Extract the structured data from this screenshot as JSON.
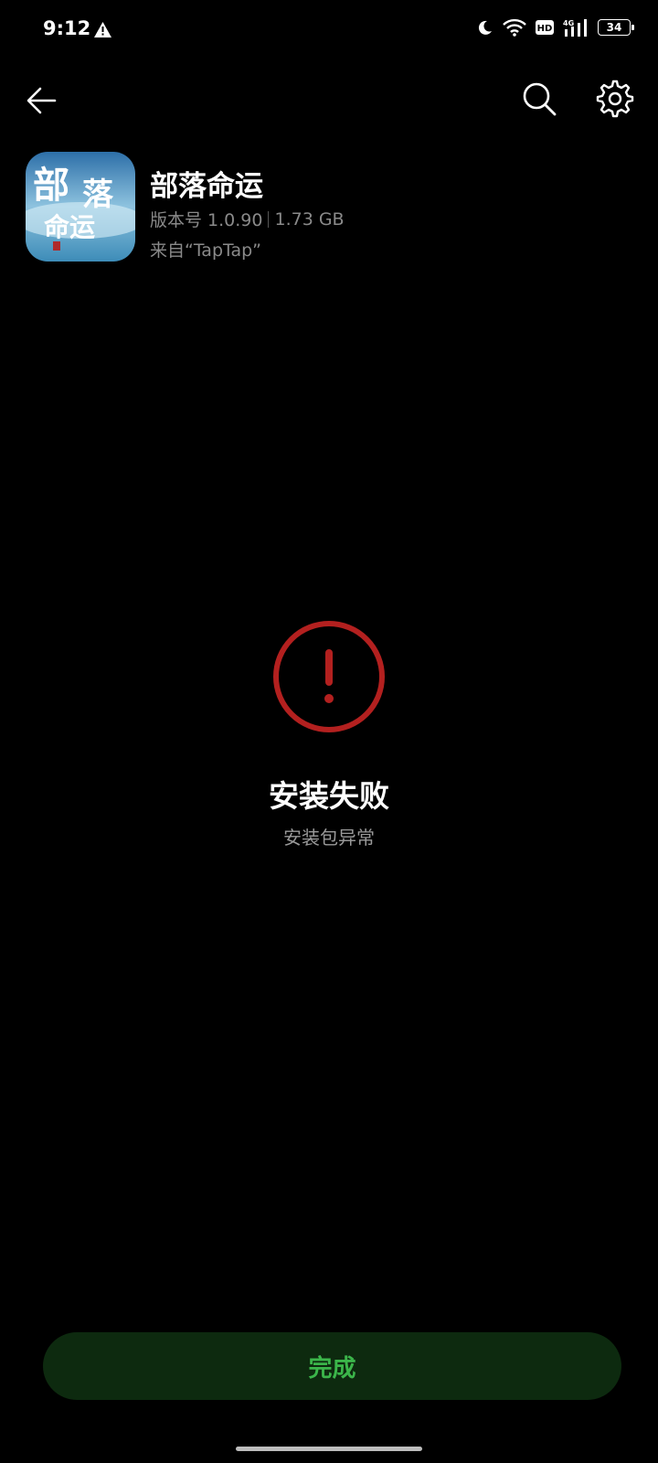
{
  "status_bar": {
    "time": "9:12",
    "warning_icon": "warning-triangle-icon",
    "icons": [
      "moon-icon",
      "wifi-icon",
      "hd-icon",
      "signal-4g-icon"
    ],
    "hd_label": "HD",
    "network_label": "4G",
    "battery_level": "34"
  },
  "top_bar": {
    "back_icon": "arrow-left-icon",
    "search_icon": "search-icon",
    "settings_icon": "gear-icon"
  },
  "app": {
    "name": "部落命运",
    "version": "版本号 1.0.90",
    "size": "1.73 GB",
    "source": "来自“TapTap”",
    "icon_text_1": "部",
    "icon_text_2": "落",
    "icon_text_3": "命运"
  },
  "result": {
    "icon": "error-circle-icon",
    "title": "安装失败",
    "subtitle": "安装包异常"
  },
  "actions": {
    "done_label": "完成"
  },
  "colors": {
    "background": "#000000",
    "error": "#b3201f",
    "done_text": "#3bb54a",
    "done_bg": "#0d2a0f"
  }
}
